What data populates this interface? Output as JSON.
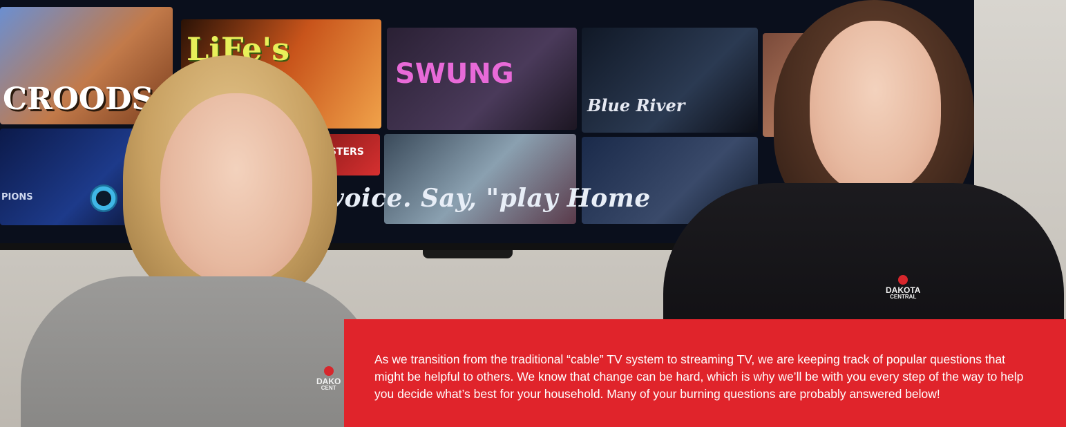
{
  "tv": {
    "tiles": [
      {
        "title": "CROODS"
      },
      {
        "title": "LiFe's"
      },
      {
        "title": "SWUNG"
      },
      {
        "title": "Blue River"
      },
      {
        "title": "ASTERS"
      },
      {
        "title": "PIONS"
      }
    ],
    "voice_prompt": "Se        using your voice. Say, \"play Home"
  },
  "staff": {
    "left_logo": "DAKO",
    "left_logo_sub": "CENT",
    "right_logo": "DAKOTA",
    "right_logo_sub": "CENTRAL"
  },
  "info_card": {
    "text": "As we transition from the traditional “cable” TV system to streaming TV, we are keeping track of popular questions that might be helpful to others. We know that change can be hard, which is why we’ll be with you every step of the way to help you decide what’s best for your household. Many of your burning questions are probably answered below!"
  },
  "colors": {
    "accent_red": "#e0242b",
    "text_white": "#ffffff"
  }
}
